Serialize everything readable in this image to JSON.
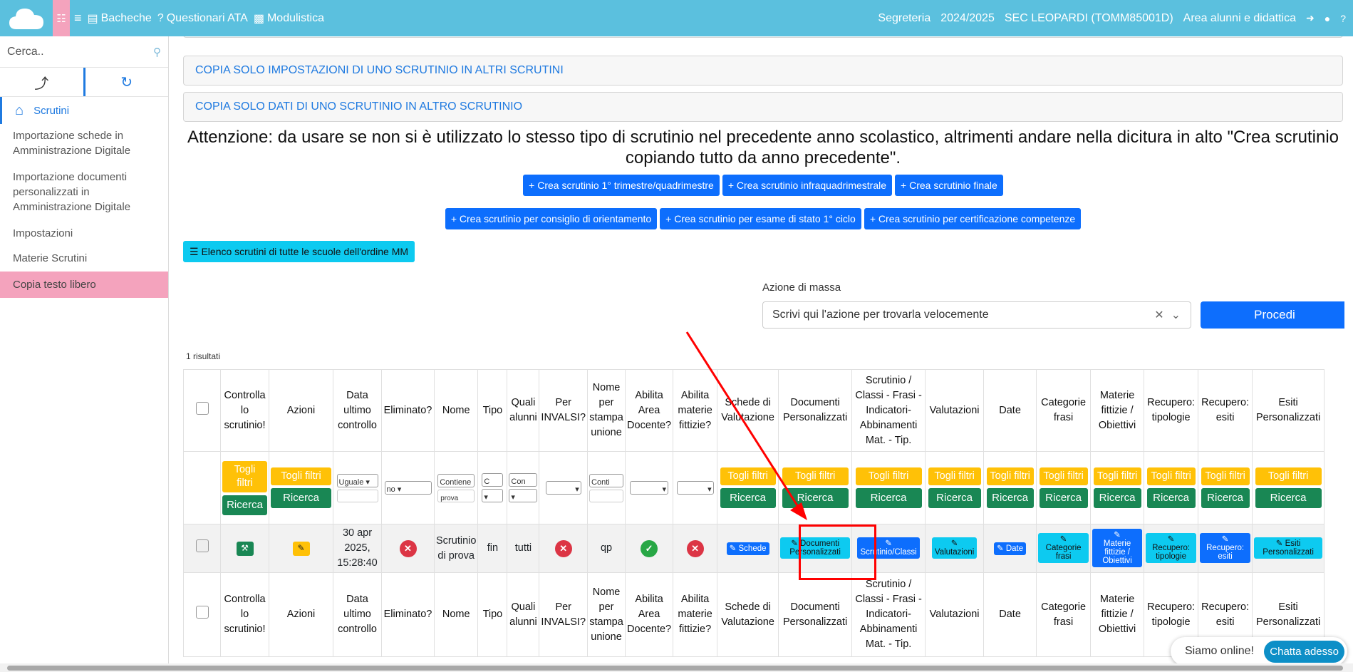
{
  "navbar": {
    "bacheche": "Bacheche",
    "questionari": "Questionari ATA",
    "modulistica": "Modulistica",
    "segreteria": "Segreteria",
    "year": "2024/2025",
    "school": "SEC LEOPARDI (TOMM85001D)",
    "area": "Area alunni e didattica"
  },
  "sidebar": {
    "search_placeholder": "Cerca..",
    "home": "Scrutini",
    "items": [
      "Importazione schede in Amministrazione Digitale",
      "Importazione documenti personalizzati in Amministrazione Digitale",
      "Impostazioni",
      "Materie Scrutini",
      "Copia testo libero"
    ]
  },
  "main": {
    "accordions": [
      "COPIA SOLO IMPOSTAZIONI DI UNO SCRUTINIO IN ALTRI SCRUTINI",
      "COPIA SOLO DATI DI UNO SCRUTINIO IN ALTRO SCRUTINIO"
    ],
    "warning": "Attenzione: da usare se non si è utilizzato lo stesso tipo di scrutinio nel precedente anno scolastico, altrimenti andare nella dicitura in alto \"Crea scrutinio copiando tutto da anno precedente\".",
    "create_buttons_row1": [
      "Crea scrutinio 1° trimestre/quadrimestre",
      "Crea scrutinio infraquadrimestrale",
      "Crea scrutinio finale"
    ],
    "create_buttons_row2": [
      "Crea scrutinio per consiglio di orientamento",
      "Crea scrutinio per esame di stato 1° ciclo",
      "Crea scrutinio per certificazione competenze"
    ],
    "elenco_button": "Elenco scrutini di tutte le scuole dell'ordine MM",
    "mass_action_label": "Azione di massa",
    "mass_action_placeholder": "Scrivi qui l'azione per trovarla velocemente",
    "procedi": "Procedi",
    "results_count": "1 risultati"
  },
  "table": {
    "headers": [
      "",
      "Controlla lo scrutinio!",
      "Azioni",
      "Data ultimo controllo",
      "Eliminato?",
      "Nome",
      "Tipo",
      "Quali alunni",
      "Per INVALSI?",
      "Nome per stampa unione",
      "Abilita Area Docente?",
      "Abilita materie fittizie?",
      "Schede di Valutazione",
      "Documenti Personalizzati",
      "Scrutinio / Classi - Frasi - Indicatori- Abbinamenti Mat. - Tip.",
      "Valutazioni",
      "Date",
      "Categorie frasi",
      "Materie fittizie / Obiettivi",
      "Recupero: tipologie",
      "Recupero: esiti",
      "Esiti Personalizzati"
    ],
    "filters": {
      "togli_filtri": "Togli filtri",
      "ricerca": "Ricerca",
      "data_select": "Uguale",
      "eliminato_select": "no",
      "nome_select": "Contiene",
      "nome_input": "prova",
      "tipo_select": "C",
      "alunni_select": "Con",
      "stampa_select": "Conti"
    },
    "row": {
      "data": "30 apr 2025, 15:28:40",
      "nome": "Scrutinio di prova",
      "tipo": "fin",
      "alunni": "tutti",
      "stampa": "qp",
      "btn_schede": "Schede",
      "btn_documenti": "Documenti Personalizzati",
      "btn_scrutinio": "Scrutinio/Classi",
      "btn_valutazioni": "Valutazioni",
      "btn_date": "Date",
      "btn_categorie": "Categorie frasi",
      "btn_materie": "Materie fittizie / Obiettivi",
      "btn_recupero_tip": "Recupero: tipologie",
      "btn_recupero_esiti": "Recupero: esiti",
      "btn_esiti": "Esiti Personalizzati"
    }
  },
  "chat": {
    "status": "Siamo online!",
    "button": "Chatta adesso"
  },
  "colors": {
    "navbar": "#5bc0de",
    "accent_pink": "#f4a3bd",
    "primary": "#0d6efd",
    "info": "#0dcaf0",
    "warning": "#ffc107",
    "success": "#198754",
    "danger": "#dc3545",
    "annotation": "#ff0000"
  }
}
